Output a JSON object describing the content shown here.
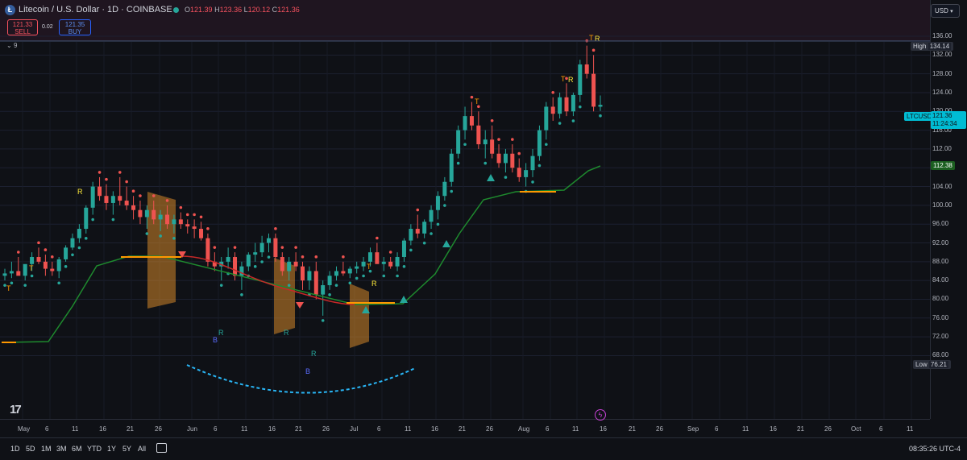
{
  "header": {
    "symbol_icon": "litecoin-icon",
    "title": "Litecoin / U.S. Dollar · 1D · COINBASE",
    "ohlc": {
      "o_label": "O",
      "o": "121.39",
      "h_label": "H",
      "h": "123.36",
      "l_label": "L",
      "l": "120.12",
      "c_label": "C",
      "c": "121.36"
    },
    "sell_price": "121.33",
    "sell_label": "SELL",
    "spread": "0.02",
    "buy_price": "121.35",
    "buy_label": "BUY",
    "indicator_count": "9",
    "currency": "USD"
  },
  "price_axis": {
    "ticks": [
      "136.00",
      "132.00",
      "128.00",
      "124.00",
      "120.00",
      "116.00",
      "112.00",
      "108.00",
      "104.00",
      "100.00",
      "96.00",
      "92.00",
      "88.00",
      "84.00",
      "80.00",
      "76.00",
      "72.00",
      "68.00"
    ],
    "high_label": "High",
    "high_value": "134.14",
    "low_label": "Low",
    "low_value": "76.21",
    "symbol_tag": "LTCUSD",
    "last_price": "121.36",
    "countdown": "11:24:34",
    "ma_value": "112.38"
  },
  "time_axis": {
    "labels": [
      "May",
      "6",
      "11",
      "16",
      "21",
      "26",
      "Jun",
      "6",
      "11",
      "16",
      "21",
      "26",
      "Jul",
      "6",
      "11",
      "16",
      "21",
      "26",
      "Aug",
      "6",
      "11",
      "16",
      "21",
      "26",
      "Sep",
      "6",
      "11",
      "16",
      "21",
      "26",
      "Oct",
      "6",
      "11"
    ]
  },
  "annotations": {
    "t": "T",
    "r": "R",
    "b": "B"
  },
  "bottom_bar": {
    "ranges": [
      "1D",
      "5D",
      "1M",
      "3M",
      "6M",
      "YTD",
      "1Y",
      "5Y",
      "All"
    ],
    "compare_icon": "calendar-compare-icon",
    "clock": "08:35:26 UTC-4"
  },
  "colors": {
    "up": "#26a69a",
    "down": "#ef5350",
    "ma": "#1e8a2e",
    "band": "#d4862a",
    "accent": "#2962ff"
  },
  "chart_data": {
    "type": "candlestick",
    "series": [
      {
        "values": [
          [
            85,
            86.5,
            84,
            85.5
          ],
          [
            85.5,
            88,
            84.5,
            86
          ],
          [
            86,
            89,
            85.5,
            85
          ],
          [
            85,
            87,
            84,
            87.5
          ],
          [
            87.5,
            90,
            86,
            89
          ],
          [
            89,
            91,
            87.5,
            88
          ],
          [
            88,
            89.5,
            85,
            86.5
          ],
          [
            86.5,
            88,
            85,
            86
          ],
          [
            86,
            89,
            84.5,
            88.5
          ],
          [
            88.5,
            91.5,
            88,
            91
          ],
          [
            91,
            94,
            90.5,
            93
          ],
          [
            93,
            96,
            92,
            95
          ],
          [
            95,
            100,
            94,
            99.5
          ],
          [
            99.5,
            105,
            98,
            104
          ],
          [
            104,
            106,
            101,
            102
          ],
          [
            102,
            104.5,
            99,
            100.5
          ],
          [
            100.5,
            103,
            98,
            102
          ],
          [
            102,
            106,
            100,
            101
          ],
          [
            101,
            104,
            99,
            100
          ],
          [
            100,
            102,
            97,
            99
          ],
          [
            99,
            101,
            96,
            97.5
          ],
          [
            97.5,
            100,
            95,
            99
          ],
          [
            99,
            101,
            96,
            97
          ],
          [
            97,
            99,
            94.5,
            98
          ],
          [
            98,
            100,
            95,
            96
          ],
          [
            96,
            98,
            94,
            97
          ],
          [
            97,
            98.5,
            95,
            96
          ],
          [
            96,
            97,
            94,
            95.5
          ],
          [
            95.5,
            97,
            93,
            95
          ],
          [
            95,
            96.5,
            92.5,
            93
          ],
          [
            93,
            94,
            87,
            88
          ],
          [
            88,
            90,
            86,
            87
          ],
          [
            87,
            89,
            84,
            88
          ],
          [
            88,
            91,
            86.5,
            89
          ],
          [
            89,
            90,
            84,
            85
          ],
          [
            85,
            88,
            82,
            87
          ],
          [
            87,
            90,
            86,
            89.5
          ],
          [
            89.5,
            92,
            88,
            90
          ],
          [
            90,
            93.5,
            89,
            92
          ],
          [
            92,
            94,
            90,
            93
          ],
          [
            93,
            94,
            88,
            89
          ],
          [
            89,
            90,
            85,
            86
          ],
          [
            86,
            89,
            84,
            88
          ],
          [
            88,
            90,
            86,
            87
          ],
          [
            87,
            88,
            82,
            84
          ],
          [
            84,
            87,
            82,
            86
          ],
          [
            86,
            88,
            80,
            81
          ],
          [
            81,
            84,
            76.5,
            83
          ],
          [
            83,
            86,
            82,
            85
          ],
          [
            85,
            87,
            84,
            86
          ],
          [
            86,
            88,
            85,
            85.5
          ],
          [
            85.5,
            87,
            84.5,
            86.5
          ],
          [
            86.5,
            88,
            85.5,
            87
          ],
          [
            87,
            89,
            86,
            88
          ],
          [
            88,
            91,
            87,
            90
          ],
          [
            90,
            92,
            88,
            87.5
          ],
          [
            87.5,
            89,
            86,
            88
          ],
          [
            88,
            89,
            86.5,
            87
          ],
          [
            87,
            90,
            86,
            89
          ],
          [
            89,
            93,
            88,
            92.5
          ],
          [
            92.5,
            96,
            91.5,
            95
          ],
          [
            95,
            98,
            93,
            94
          ],
          [
            94,
            97,
            93,
            96.5
          ],
          [
            96.5,
            100,
            95,
            99
          ],
          [
            99,
            103,
            97,
            102
          ],
          [
            102,
            106,
            101,
            105
          ],
          [
            105,
            112,
            104,
            111
          ],
          [
            111,
            117,
            110,
            116
          ],
          [
            116,
            121,
            114,
            119
          ],
          [
            119,
            122,
            116,
            117
          ],
          [
            117,
            120,
            112,
            113
          ],
          [
            113,
            116,
            110,
            114
          ],
          [
            114,
            117,
            110,
            111
          ],
          [
            111,
            113,
            108,
            109
          ],
          [
            109,
            112,
            107,
            111
          ],
          [
            111,
            113,
            107,
            108
          ],
          [
            108,
            110,
            105,
            106
          ],
          [
            106,
            109,
            104,
            107.5
          ],
          [
            107.5,
            112,
            106,
            110.5
          ],
          [
            110.5,
            117,
            109.5,
            116
          ],
          [
            116,
            122,
            114,
            121
          ],
          [
            121,
            123,
            118,
            119.5
          ],
          [
            119.5,
            124,
            118.5,
            123
          ],
          [
            123,
            126,
            119,
            120
          ],
          [
            120,
            124,
            119,
            123.5
          ],
          [
            123.5,
            131,
            122,
            130
          ],
          [
            130,
            134,
            127,
            128
          ],
          [
            128,
            132,
            120,
            121
          ],
          [
            121,
            123.4,
            120.1,
            121.4
          ]
        ]
      }
    ],
    "ma_line": "smoothed"
  }
}
